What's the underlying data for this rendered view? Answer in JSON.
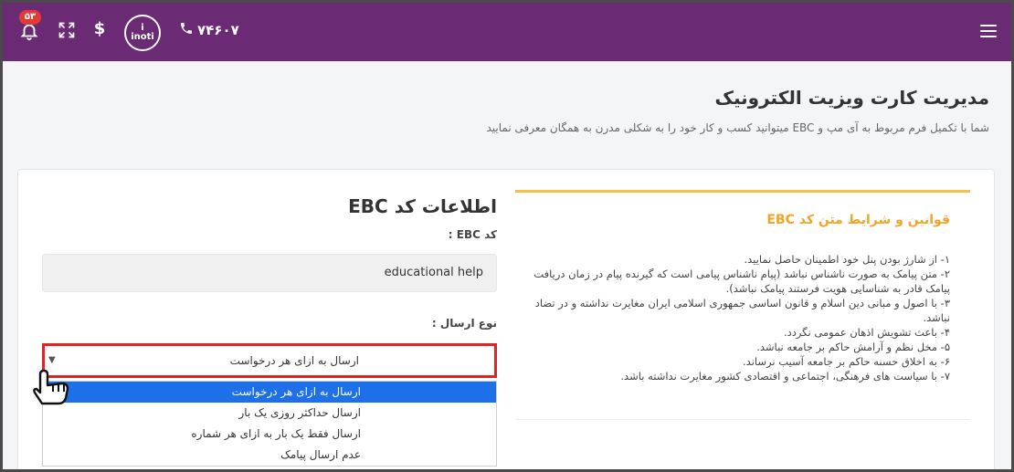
{
  "header": {
    "notifications_count": "۵۳",
    "logo_text_top": "i",
    "logo_text_bottom": "inoti",
    "phone_number": "۷۴۶۰۷",
    "dollar_symbol": "$",
    "icons": [
      "bell-icon",
      "expand-icon",
      "dollar-icon",
      "inoti-logo",
      "phone-icon",
      "hamburger-menu-icon"
    ],
    "background_color": "#6a2a74"
  },
  "page": {
    "title": "مدیریت کارت ویزیت الکترونیک",
    "subtitle": "شما با تکمیل فرم مربوط به آی مپ و EBC میتوانید کسب و کار خود را به شکلی مدرن به همگان معرفی نمایید"
  },
  "form": {
    "title": "اطلاعات کد EBC",
    "code_label": "کد EBC :",
    "code_value": "educational help",
    "type_label": "نوع ارسال :",
    "selected_type": "ارسال به ازای هر درخواست",
    "type_options": [
      "ارسال به ازای هر درخواست",
      "ارسال حداکثر روزی یک بار",
      "ارسال فقط یک بار به ازای هر شماره",
      "عدم ارسال پیامک"
    ],
    "highlight_color": "#e02424",
    "selected_option_color": "#1e70e8"
  },
  "rules": {
    "title": "قوانین و شرایط متن کد EBC",
    "title_color": "#f0a526",
    "items": [
      "۱- از شارژ بودن پنل خود اطمینان حاصل نمایید.",
      "۲- متن پیامک به صورت ناشناس نباشد (پیام ناشناس پیامی است که گیرنده پیام در زمان دریافت پیامک قادر به شناسایی هویت فرستند پیامک نباشد).",
      "۳- با اصول و مبانی دین اسلام و قانون اساسی جمهوری اسلامی ایران مغایرت نداشته و در تضاد نباشد.",
      "۴- باعث تشویش اذهان عمومی نگردد.",
      "۵- مخل نظم و آرامش حاکم بر جامعه نباشد.",
      "۶- به اخلاق حسنه حاکم بر جامعه آسیب نرساند.",
      "۷- با سیاست های فرهنگی، اجتماعی و اقتصادی کشور مغایرت نداشته باشد."
    ]
  }
}
